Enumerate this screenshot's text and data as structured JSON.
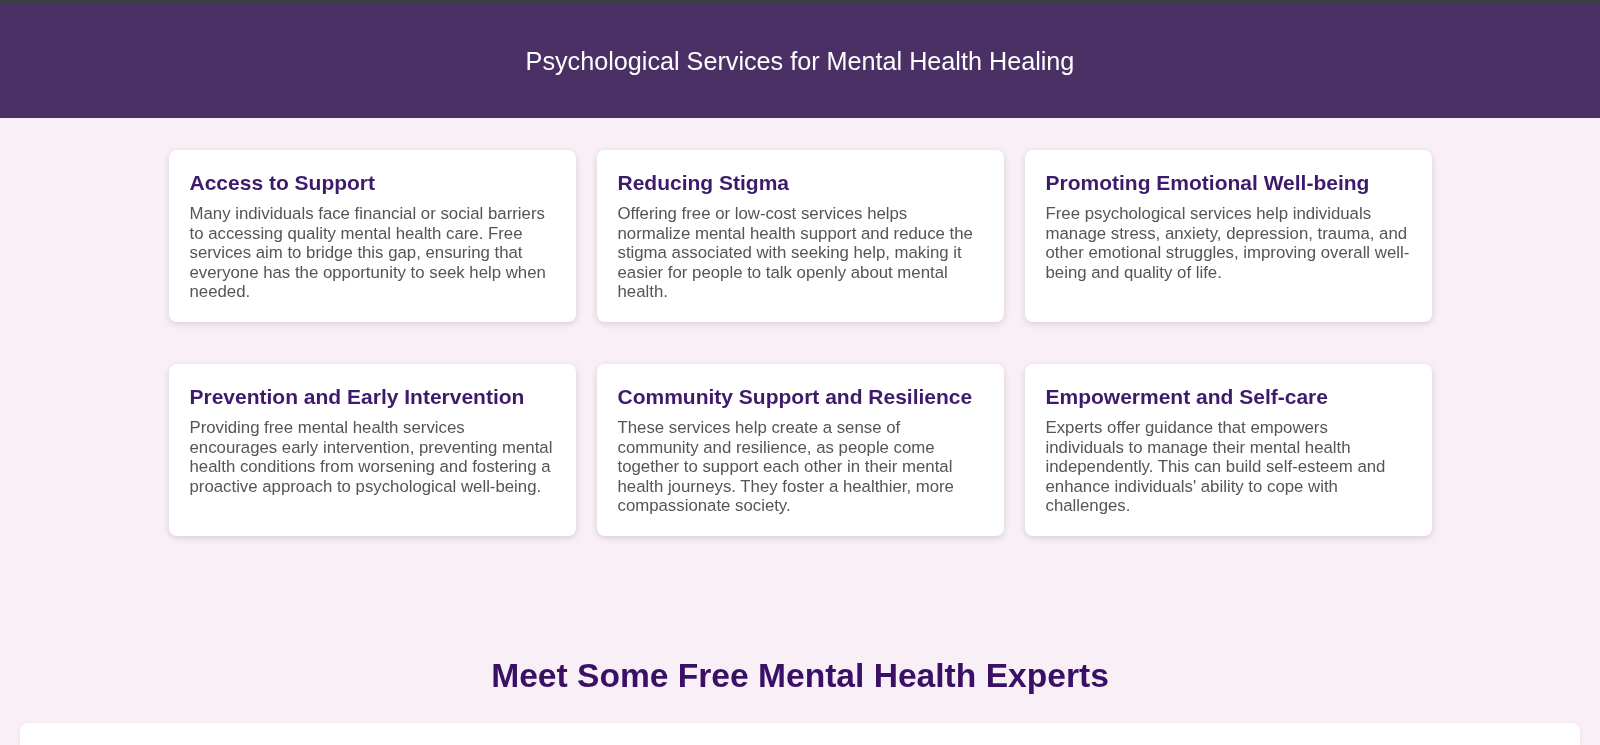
{
  "header": {
    "title": "Psychological Services for Mental Health Healing"
  },
  "cards": [
    {
      "title": "Access to Support",
      "text": "Many individuals face financial or social barriers to accessing quality mental health care. Free services aim to bridge this gap, ensuring that everyone has the opportunity to seek help when needed."
    },
    {
      "title": "Reducing Stigma",
      "text": "Offering free or low-cost services helps normalize mental health support and reduce the stigma associated with seeking help, making it easier for people to talk openly about mental health."
    },
    {
      "title": "Promoting Emotional Well-being",
      "text": "Free psychological services help individuals manage stress, anxiety, depression, trauma, and other emotional struggles, improving overall well-being and quality of life."
    },
    {
      "title": "Prevention and Early Intervention",
      "text": "Providing free mental health services encourages early intervention, preventing mental health conditions from worsening and fostering a proactive approach to psychological well-being."
    },
    {
      "title": "Community Support and Resilience",
      "text": "These services help create a sense of community and resilience, as people come together to support each other in their mental health journeys. They foster a healthier, more compassionate society."
    },
    {
      "title": "Empowerment and Self-care",
      "text": "Experts offer guidance that empowers individuals to manage their mental health independently. This can build self-esteem and enhance individuals' ability to cope with challenges."
    }
  ],
  "experts": {
    "heading": "Meet Some Free Mental Health Experts"
  }
}
